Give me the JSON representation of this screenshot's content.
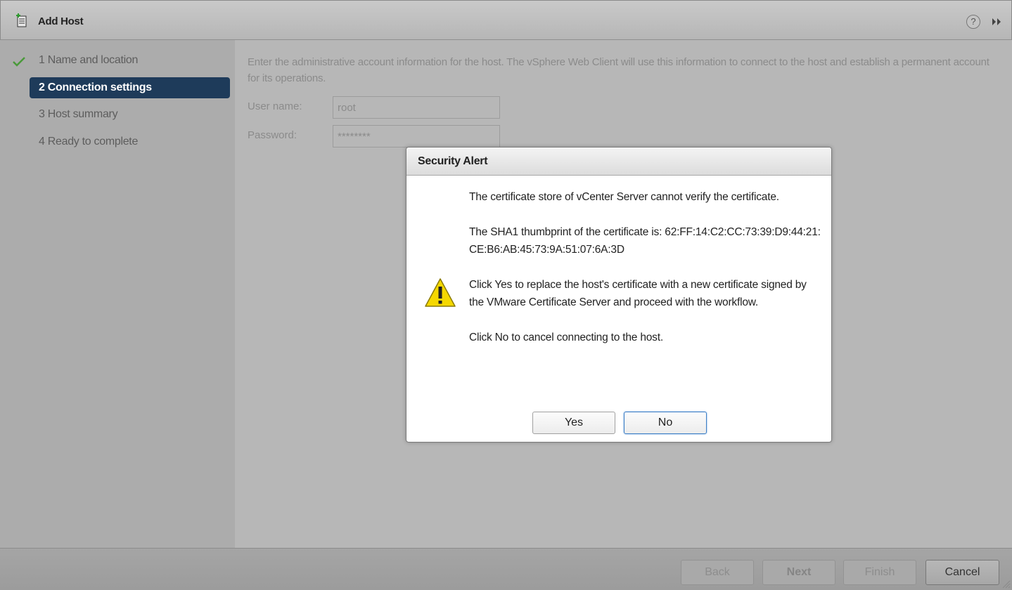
{
  "header": {
    "title": "Add Host",
    "help_glyph": "?",
    "icons": [
      "host-add-icon",
      "help-icon",
      "expand-icon"
    ]
  },
  "sidebar": {
    "steps": [
      {
        "label": "1  Name and location",
        "state": "completed"
      },
      {
        "label": "2  Connection settings",
        "state": "active"
      },
      {
        "label": "3  Host summary",
        "state": "pending"
      },
      {
        "label": "4  Ready to complete",
        "state": "pending"
      }
    ]
  },
  "main": {
    "intro": "Enter the administrative account information for the host. The vSphere Web Client will use this information to connect to the host and establish a permanent account for its operations.",
    "username_label": "User name:",
    "username_value": "root",
    "password_label": "Password:",
    "password_value": "********"
  },
  "dialog": {
    "title": "Security Alert",
    "paragraphs": [
      "The certificate store of vCenter Server cannot verify the certificate.",
      "The SHA1 thumbprint of the certificate is: 62:FF:14:C2:CC:73:39:D9:44:21:CE:B6:AB:45:73:9A:51:07:6A:3D",
      "Click Yes to replace the host's certificate with a new certificate signed by the VMware Certificate Server and proceed with the workflow.",
      "Click No to cancel connecting to the host."
    ],
    "yes_label": "Yes",
    "no_label": "No",
    "icon": "warning-icon"
  },
  "footer": {
    "back_label": "Back",
    "next_label": "Next",
    "finish_label": "Finish",
    "cancel_label": "Cancel"
  },
  "colors": {
    "active_step": "#1e3b5a",
    "check": "#4a9a3a",
    "warning_fill": "#f5d800"
  }
}
